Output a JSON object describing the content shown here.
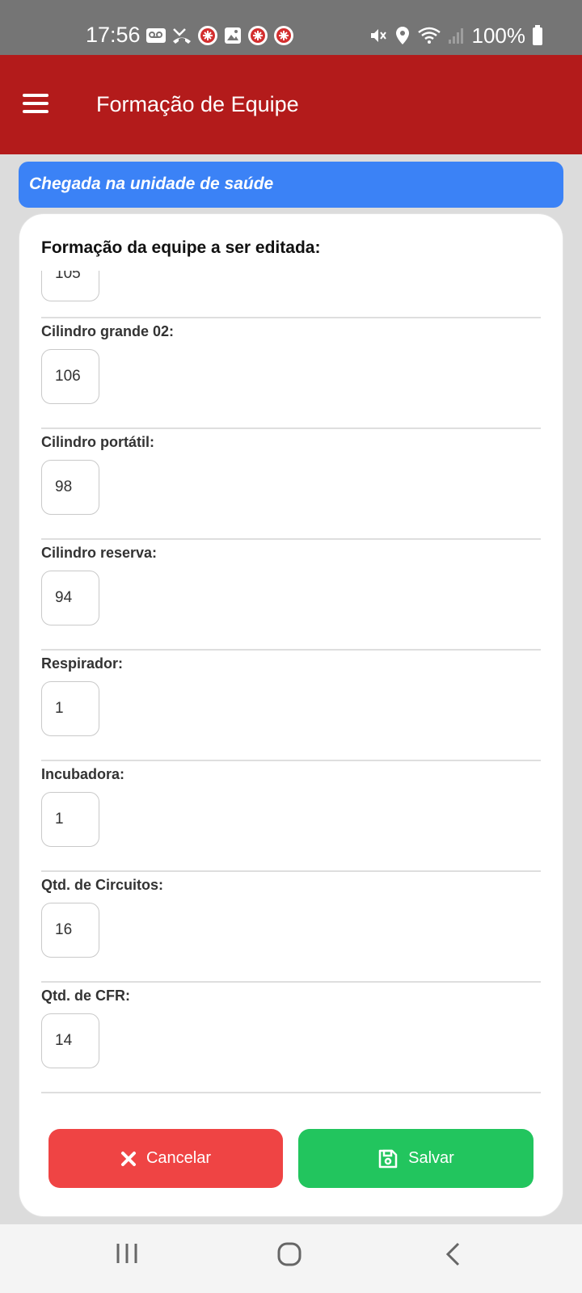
{
  "status_bar": {
    "time": "17:56",
    "battery": "100%",
    "left_icons": [
      "voicemail-icon",
      "missed-call-icon",
      "app-badge-icon",
      "gallery-icon",
      "app-badge-icon",
      "app-badge-icon"
    ],
    "right_icons": [
      "mute-icon",
      "location-icon",
      "wifi-icon",
      "signal-icon",
      "battery-icon"
    ]
  },
  "app_bar": {
    "title": "Formação de Equipe",
    "menu_icon": "hamburger-menu-icon",
    "background_color": "#b31b1b"
  },
  "section": {
    "title": "Chegada na unidade de saúde",
    "color": "#3b82f6"
  },
  "form": {
    "title": "Formação da equipe a ser editada:",
    "fields": [
      {
        "label": "",
        "value": "105"
      },
      {
        "label": "Cilindro grande 02:",
        "value": "106"
      },
      {
        "label": "Cilindro portátil:",
        "value": "98"
      },
      {
        "label": "Cilindro reserva:",
        "value": "94"
      },
      {
        "label": "Respirador:",
        "value": "1"
      },
      {
        "label": "Incubadora:",
        "value": "1"
      },
      {
        "label": "Qtd. de Circuitos:",
        "value": "16"
      },
      {
        "label": "Qtd. de CFR:",
        "value": "14"
      }
    ]
  },
  "actions": {
    "cancel_label": "Cancelar",
    "cancel_icon": "close-icon",
    "cancel_color": "#ef4444",
    "save_label": "Salvar",
    "save_icon": "save-icon",
    "save_color": "#22c55e"
  },
  "nav_bar": {
    "icons": [
      "recent-apps-icon",
      "home-icon",
      "back-icon"
    ]
  }
}
